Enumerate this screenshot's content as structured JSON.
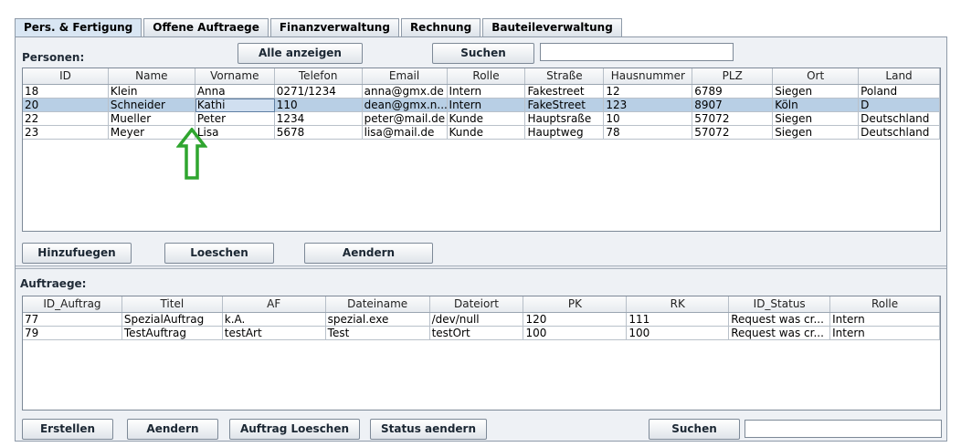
{
  "tabs": [
    "Pers. & Fertigung",
    "Offene Auftraege",
    "Finanzverwaltung",
    "Rechnung",
    "Bauteileverwaltung"
  ],
  "personen": {
    "label": "Personen:",
    "show_all_label": "Alle anzeigen",
    "search_label": "Suchen",
    "search_value": "",
    "columns": [
      "ID",
      "Name",
      "Vorname",
      "Telefon",
      "Email",
      "Rolle",
      "Straße",
      "Hausnummer",
      "PLZ",
      "Ort",
      "Land"
    ],
    "rows": [
      [
        "18",
        "Klein",
        "Anna",
        "0271/1234",
        "anna@gmx.de",
        "Intern",
        "Fakestreet",
        "12",
        "6789",
        "Siegen",
        "Poland"
      ],
      [
        "20",
        "Schneider",
        "Kathi",
        "110",
        "dean@gmx.n...",
        "Intern",
        "FakeStreet",
        "123",
        "8907",
        "Köln",
        "D"
      ],
      [
        "22",
        "Mueller",
        "Peter",
        "1234",
        "peter@mail.de",
        "Kunde",
        "Hauptsraße",
        "10",
        "57072",
        "Siegen",
        "Deutschland"
      ],
      [
        "23",
        "Meyer",
        "Lisa",
        "5678",
        "lisa@mail.de",
        "Kunde",
        "Hauptweg",
        "78",
        "57072",
        "Siegen",
        "Deutschland"
      ]
    ],
    "selected_row": 1,
    "buttons": {
      "add": "Hinzufuegen",
      "delete": "Loeschen",
      "edit": "Aendern"
    }
  },
  "auftraege": {
    "label": "Auftraege:",
    "columns": [
      "ID_Auftrag",
      "Titel",
      "AF",
      "Dateiname",
      "Dateiort",
      "PK",
      "RK",
      "ID_Status",
      "Rolle"
    ],
    "rows": [
      [
        "77",
        "SpezialAuftrag",
        "k.A.",
        "spezial.exe",
        "/dev/null",
        "120",
        "111",
        "Request was cr...",
        "Intern"
      ],
      [
        "79",
        "TestAuftrag",
        "testArt",
        "Test",
        "testOrt",
        "100",
        "100",
        "Request was cr...",
        "Intern"
      ]
    ],
    "buttons": {
      "create": "Erstellen",
      "edit": "Aendern",
      "delete": "Auftrag Loeschen",
      "status": "Status aendern",
      "search": "Suchen"
    },
    "search_value": ""
  },
  "annotation": {
    "arrow_color": "#2fa52f"
  }
}
